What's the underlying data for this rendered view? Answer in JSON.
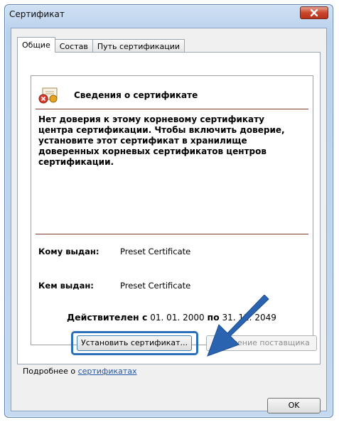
{
  "window": {
    "title": "Сертификат"
  },
  "tabs": [
    {
      "label": "Общие"
    },
    {
      "label": "Состав"
    },
    {
      "label": "Путь сертификации"
    }
  ],
  "info": {
    "title": "Сведения о сертификате",
    "warning_lines": [
      "Нет доверия к этому корневому сертификату",
      "центра сертификации. Чтобы включить  доверие,",
      "установите этот сертификат в хранилище",
      "доверенных корневых сертификатов центров",
      "сертификации."
    ],
    "issued_to_label": "Кому выдан:",
    "issued_to_value": "Preset Certificate",
    "issued_by_label": "Кем выдан:",
    "issued_by_value": "Preset Certificate",
    "valid_from_label": "Действителен с",
    "valid_from": "01. 01. 2000",
    "valid_to_label": "по",
    "valid_to": "31. 12. 2049"
  },
  "buttons": {
    "install": "Установить сертификат...",
    "issuer_statement": "Заявление поставщика",
    "ok": "OK"
  },
  "more": {
    "prefix": "Подробнее о ",
    "link": "сертификатах"
  },
  "colors": {
    "highlight": "#2a6fb8",
    "close": "#c9462c"
  },
  "icons": [
    "close-icon",
    "certificate-icon",
    "arrow-pointer-icon"
  ]
}
